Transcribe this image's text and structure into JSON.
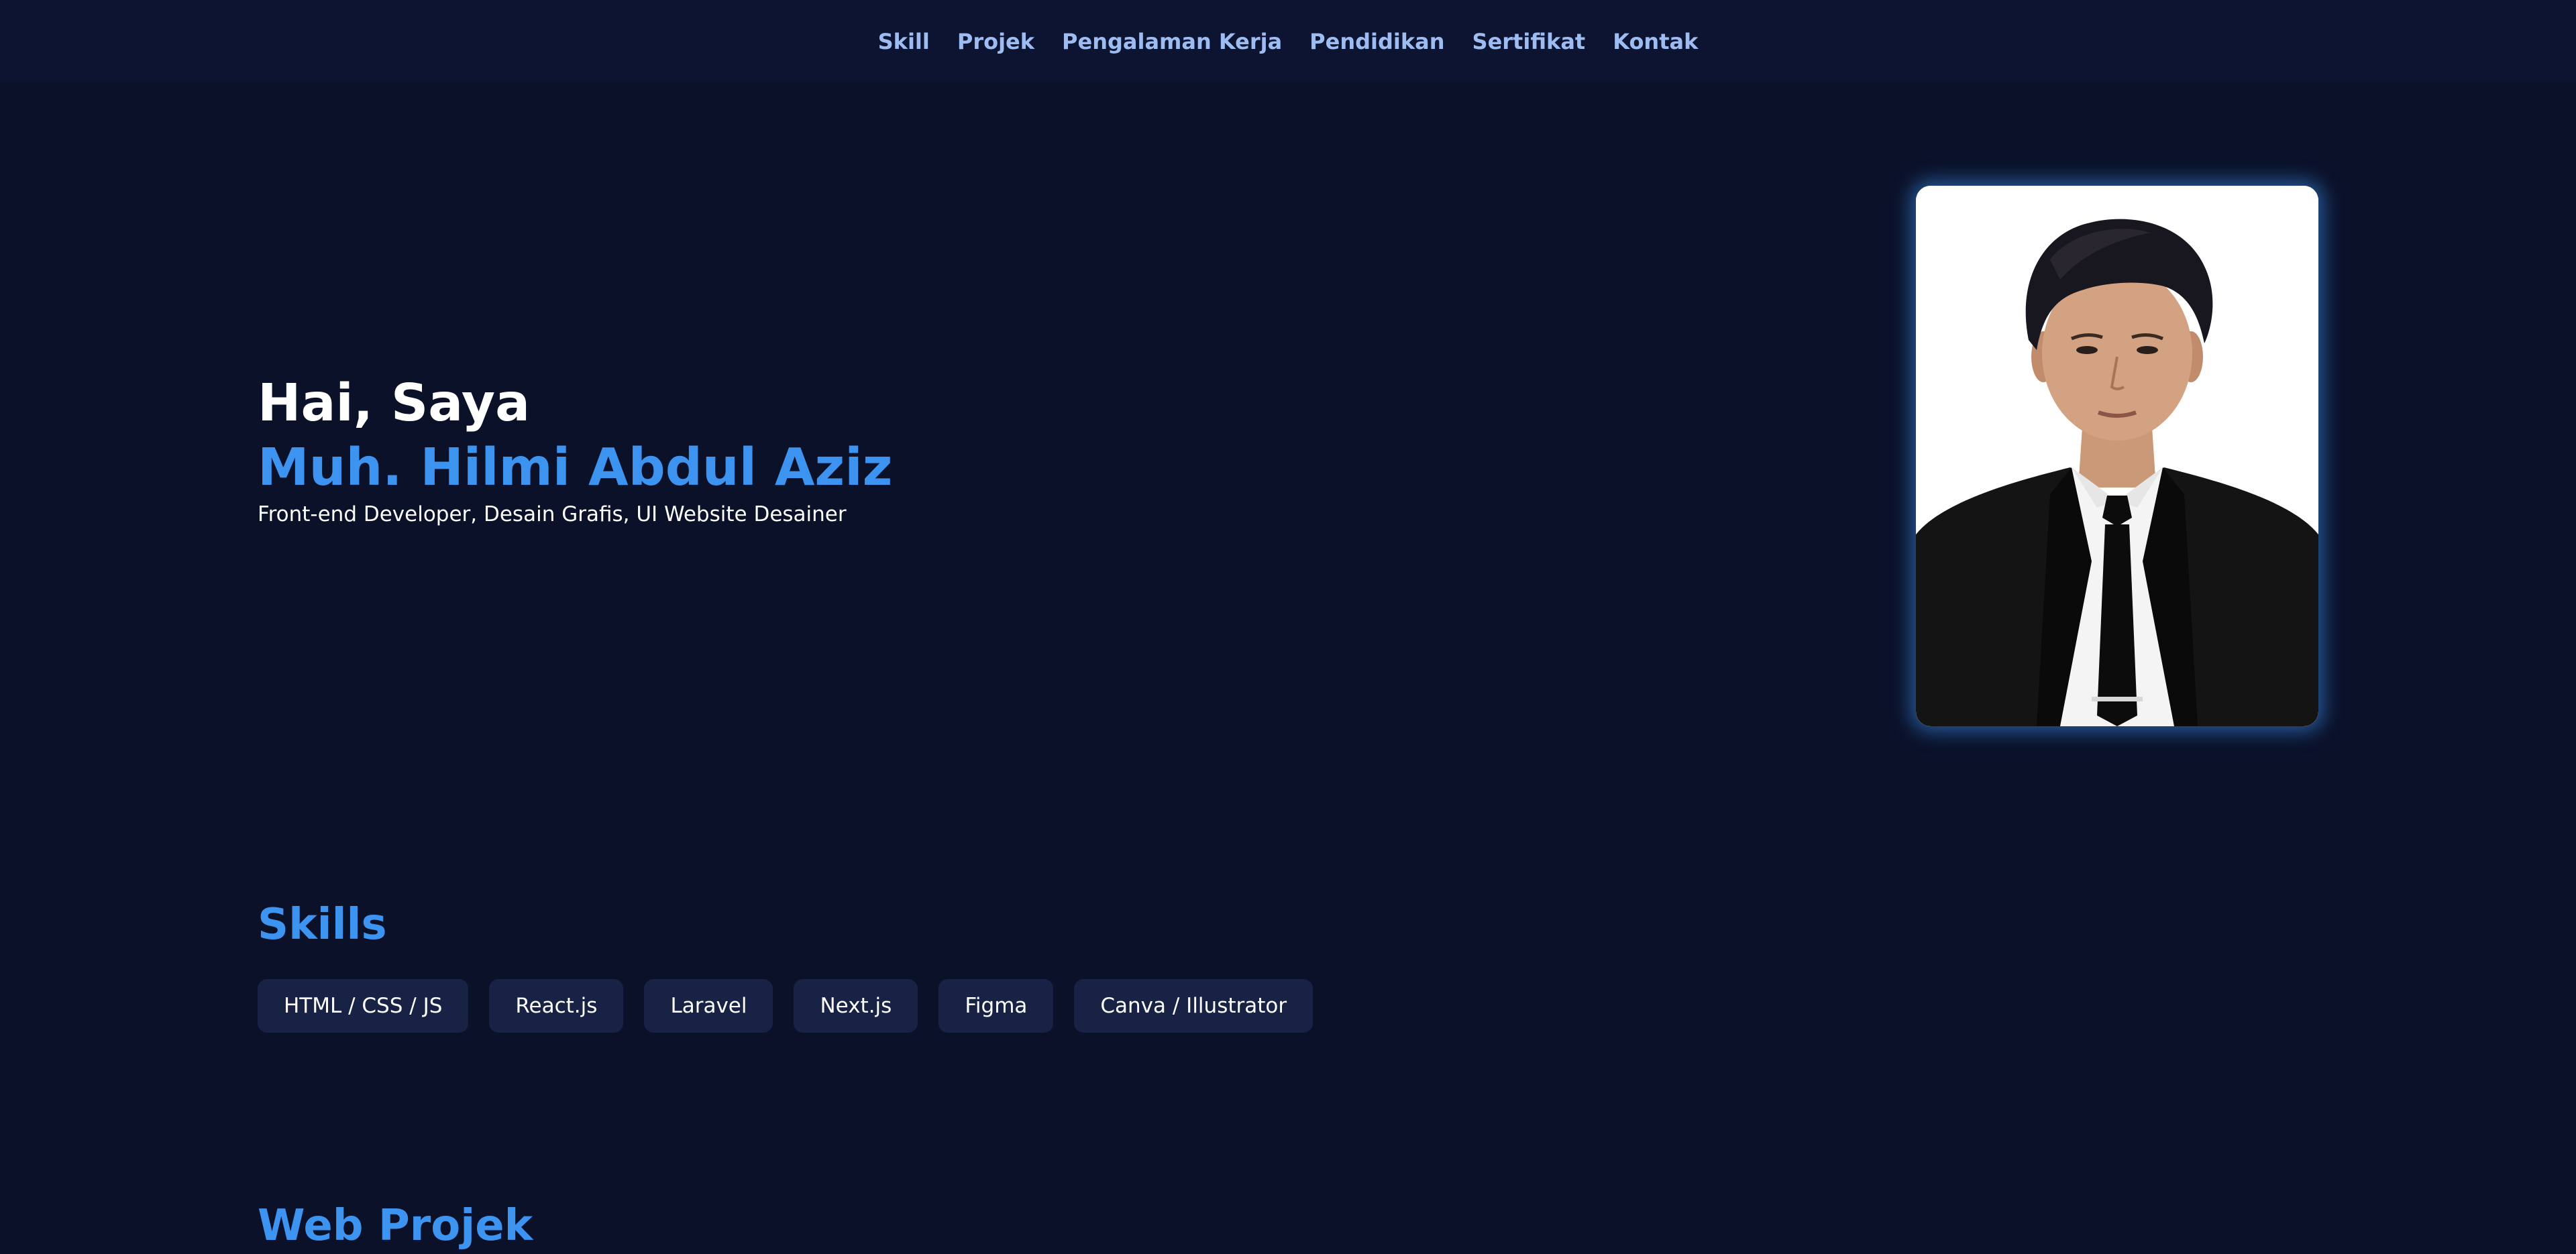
{
  "nav": {
    "items": [
      {
        "label": "Skill"
      },
      {
        "label": "Projek"
      },
      {
        "label": "Pengalaman Kerja"
      },
      {
        "label": "Pendidikan"
      },
      {
        "label": "Sertifikat"
      },
      {
        "label": "Kontak"
      }
    ]
  },
  "hero": {
    "greeting": "Hai, Saya",
    "name": "Muh. Hilmi Abdul Aziz",
    "tagline": "Front-end Developer, Desain Grafis, UI Website Desainer"
  },
  "skills": {
    "title": "Skills",
    "items": [
      {
        "label": "HTML / CSS / JS"
      },
      {
        "label": "React.js"
      },
      {
        "label": "Laravel"
      },
      {
        "label": "Next.js"
      },
      {
        "label": "Figma"
      },
      {
        "label": "Canva / Illustrator"
      }
    ]
  },
  "projects": {
    "title": "Web Projek"
  },
  "colors": {
    "background": "#0b1129",
    "navbar": "#0d1431",
    "accent": "#3d93f0",
    "nav_text": "#9dbdf2",
    "chip": "#172245"
  }
}
